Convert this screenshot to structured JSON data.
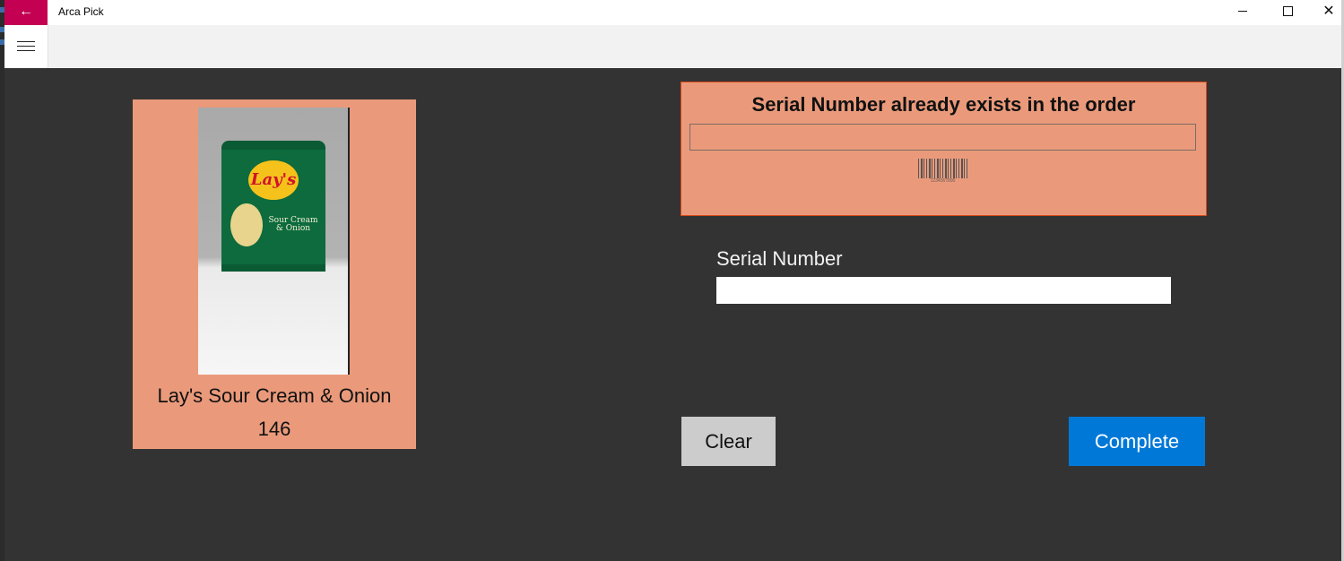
{
  "window": {
    "title": "Arca Pick",
    "back_icon": "arrow-left-icon",
    "back_glyph": "←",
    "close_glyph": "✕",
    "accent": "#c30052"
  },
  "nav": {
    "menu_icon": "hamburger-icon"
  },
  "product": {
    "name": "Lay's Sour Cream & Onion",
    "quantity": "146",
    "image_alt": "Lay's Sour Cream & Onion bag",
    "bag_brand": "Lay's",
    "bag_flavor": "Sour Cream & Onion",
    "card_color": "#ea9a7b"
  },
  "error_panel": {
    "message": "Serial Number already exists in the order",
    "input_value": "",
    "barcode_icon": "barcode-icon",
    "barcode_text": "1234567890",
    "border_color": "#d94a1a"
  },
  "serial_number": {
    "label": "Serial Number",
    "value": ""
  },
  "actions": {
    "clear_label": "Clear",
    "complete_label": "Complete",
    "complete_color": "#0078d7"
  },
  "theme": {
    "content_bg": "#333333",
    "nav_bg": "#f2f2f2"
  }
}
